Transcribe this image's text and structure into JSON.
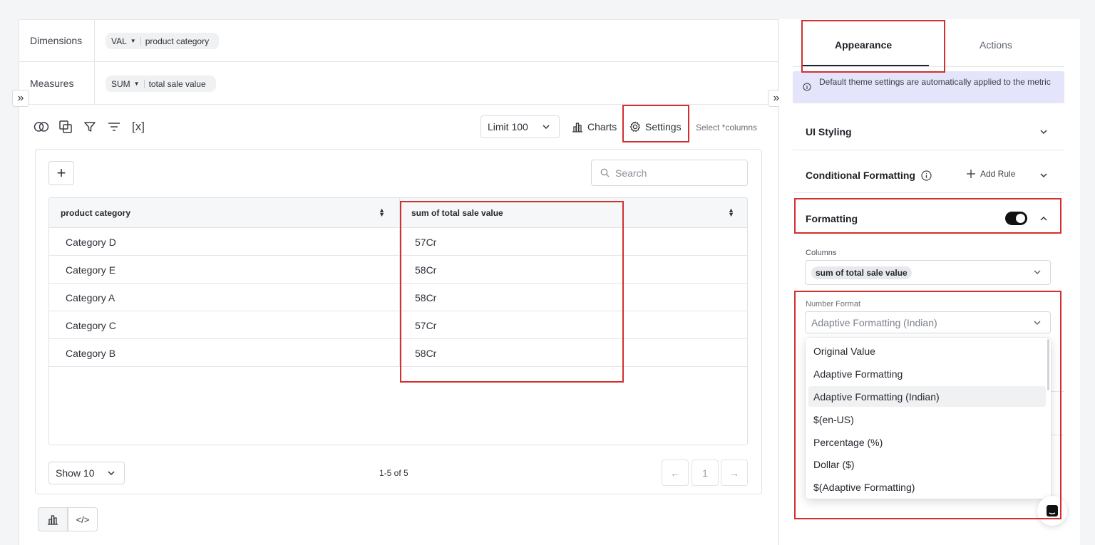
{
  "query": {
    "dimensions_label": "Dimensions",
    "dimension_pill": {
      "agg": "VAL",
      "field": "product category"
    },
    "measures_label": "Measures",
    "measure_pill": {
      "agg": "SUM",
      "field": "total sale value"
    }
  },
  "toolbar": {
    "icons": [
      "join-icon",
      "copy-icon",
      "filter-icon",
      "sort-icon",
      "variable-icon"
    ],
    "variable_text": "[x]",
    "limit_label": "Limit",
    "limit_value": "100",
    "charts_label": "Charts",
    "settings_label": "Settings",
    "select_columns": "Select *columns"
  },
  "table": {
    "add_symbol": "+",
    "search_placeholder": "Search",
    "columns": [
      "product category",
      "sum of total sale value"
    ],
    "rows": [
      [
        "Category D",
        "57Cr"
      ],
      [
        "Category E",
        "58Cr"
      ],
      [
        "Category A",
        "58Cr"
      ],
      [
        "Category C",
        "57Cr"
      ],
      [
        "Category B",
        "58Cr"
      ]
    ],
    "show_label": "Show",
    "show_value": "10",
    "page_info": "1-5 of 5",
    "current_page": "1"
  },
  "panel": {
    "tabs": [
      "Appearance",
      "Actions"
    ],
    "active_tab": "Appearance",
    "info_text": "Default theme settings are automatically applied to the metric",
    "ui_styling": "UI Styling",
    "conditional_formatting": "Conditional Formatting",
    "add_rule": "Add Rule",
    "formatting": "Formatting",
    "formatting_enabled": true,
    "columns_label": "Columns",
    "selected_column": "sum of total sale value",
    "number_format_label": "Number Format",
    "number_format_value": "Adaptive Formatting (Indian)",
    "number_format_options": [
      "Original Value",
      "Adaptive Formatting",
      "Adaptive Formatting (Indian)",
      "$(en-US)",
      "Percentage (%)",
      "Dollar ($)",
      "$(Adaptive Formatting)"
    ],
    "highlighted_option": "Adaptive Formatting (Indian)"
  },
  "colors": {
    "annotation": "#d32f2f",
    "info_bg": "#e4e4fb",
    "toggle_on": "#111111"
  }
}
